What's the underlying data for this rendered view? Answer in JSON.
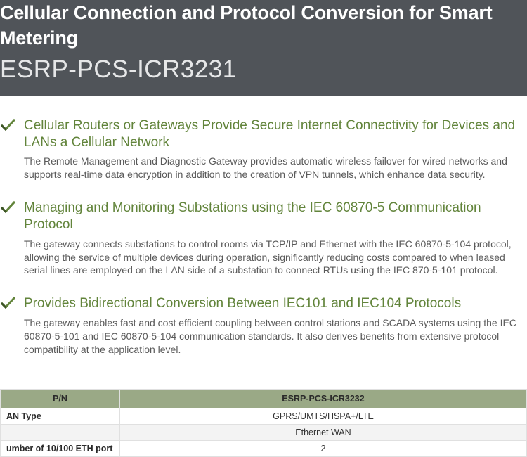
{
  "hero": {
    "title": "Cellular Connection and Protocol Conversion for Smart Metering",
    "code": "ESRP-PCS-ICR3231"
  },
  "features": [
    {
      "heading": "Cellular Routers or Gateways Provide Secure Internet Connectivity for Devices and LANs a Cellular Network",
      "text": "The Remote Management and Diagnostic Gateway provides automatic wireless failover for wired networks and supports real-time data encryption in addition to the creation of VPN tunnels, which enhance data security."
    },
    {
      "heading": "Managing and Monitoring Substations using the IEC 60870-5 Communication Protocol",
      "text": "The gateway connects substations to control rooms via TCP/IP and Ethernet with the IEC 60870-5-104 protocol, allowing the service of multiple devices during operation, significantly reducing costs compared to when leased serial lines are employed on the LAN side of a substation to connect RTUs using the IEC 870-5-101 protocol."
    },
    {
      "heading": "Provides Bidirectional Conversion Between IEC101 and IEC104 Protocols",
      "text": "The gateway enables fast and cost efficient coupling between control stations and SCADA systems using the IEC 60870-5-101 and IEC 60870-5-104 communication standards. It also derives benefits from extensive protocol compatibility at the application level."
    }
  ],
  "table": {
    "col_label": "P/N",
    "col_value": "ESRP-PCS-ICR3232",
    "rows": [
      {
        "label": "AN Type",
        "value": "GPRS/UMTS/HSPA+/LTE"
      },
      {
        "label": "",
        "value": "Ethernet WAN"
      },
      {
        "label": "umber of 10/100 ETH port",
        "value": "2"
      }
    ]
  }
}
